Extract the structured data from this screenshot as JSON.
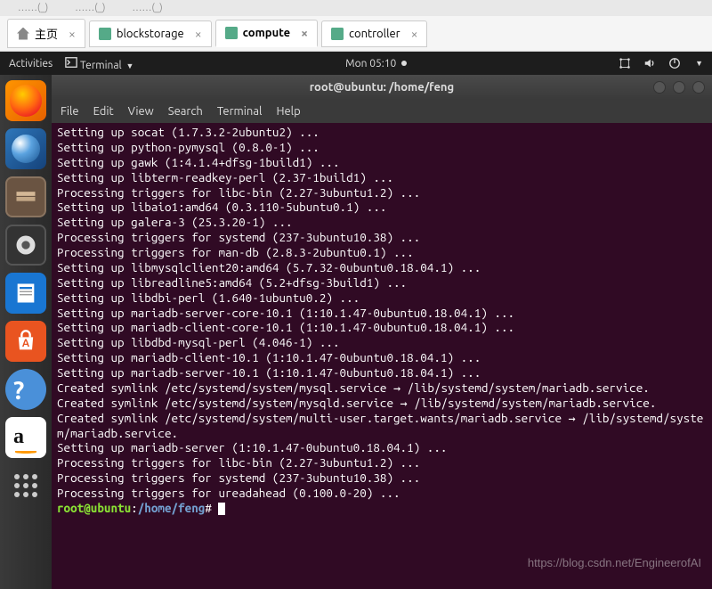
{
  "top_fragments": [
    "……(_)",
    "……(_)",
    "……(_)"
  ],
  "tabs": [
    {
      "label": "主页",
      "icon": "home",
      "active": false
    },
    {
      "label": "blockstorage",
      "icon": "server",
      "active": false
    },
    {
      "label": "compute",
      "icon": "server",
      "active": true
    },
    {
      "label": "controller",
      "icon": "server",
      "active": false
    }
  ],
  "topbar": {
    "activities": "Activities",
    "app_indicator": "Terminal",
    "clock": "Mon 05:10"
  },
  "window": {
    "title": "root@ubuntu: /home/feng"
  },
  "menubar": [
    "File",
    "Edit",
    "View",
    "Search",
    "Terminal",
    "Help"
  ],
  "terminal_lines": [
    "Setting up socat (1.7.3.2-2ubuntu2) ...",
    "Setting up python-pymysql (0.8.0-1) ...",
    "Setting up gawk (1:4.1.4+dfsg-1build1) ...",
    "Setting up libterm-readkey-perl (2.37-1build1) ...",
    "Processing triggers for libc-bin (2.27-3ubuntu1.2) ...",
    "Setting up libaio1:amd64 (0.3.110-5ubuntu0.1) ...",
    "Setting up galera-3 (25.3.20-1) ...",
    "Processing triggers for systemd (237-3ubuntu10.38) ...",
    "Processing triggers for man-db (2.8.3-2ubuntu0.1) ...",
    "Setting up libmysqlclient20:amd64 (5.7.32-0ubuntu0.18.04.1) ...",
    "Setting up libreadline5:amd64 (5.2+dfsg-3build1) ...",
    "Setting up libdbi-perl (1.640-1ubuntu0.2) ...",
    "Setting up mariadb-server-core-10.1 (1:10.1.47-0ubuntu0.18.04.1) ...",
    "Setting up mariadb-client-core-10.1 (1:10.1.47-0ubuntu0.18.04.1) ...",
    "Setting up libdbd-mysql-perl (4.046-1) ...",
    "Setting up mariadb-client-10.1 (1:10.1.47-0ubuntu0.18.04.1) ...",
    "Setting up mariadb-server-10.1 (1:10.1.47-0ubuntu0.18.04.1) ...",
    "Created symlink /etc/systemd/system/mysql.service → /lib/systemd/system/mariadb.service.",
    "Created symlink /etc/systemd/system/mysqld.service → /lib/systemd/system/mariadb.service.",
    "Created symlink /etc/systemd/system/multi-user.target.wants/mariadb.service → /lib/systemd/system/mariadb.service.",
    "Setting up mariadb-server (1:10.1.47-0ubuntu0.18.04.1) ...",
    "Processing triggers for libc-bin (2.27-3ubuntu1.2) ...",
    "Processing triggers for systemd (237-3ubuntu10.38) ...",
    "Processing triggers for ureadahead (0.100.0-20) ..."
  ],
  "prompt": {
    "user_host": "root@ubuntu",
    "sep": ":",
    "path": "/home/feng",
    "suffix": "#"
  },
  "watermark": "https://blog.csdn.net/EngineerofAI",
  "launcher_items": [
    "firefox",
    "thunderbird",
    "files",
    "rhythmbox",
    "writer",
    "software",
    "help",
    "amazon",
    "apps"
  ]
}
